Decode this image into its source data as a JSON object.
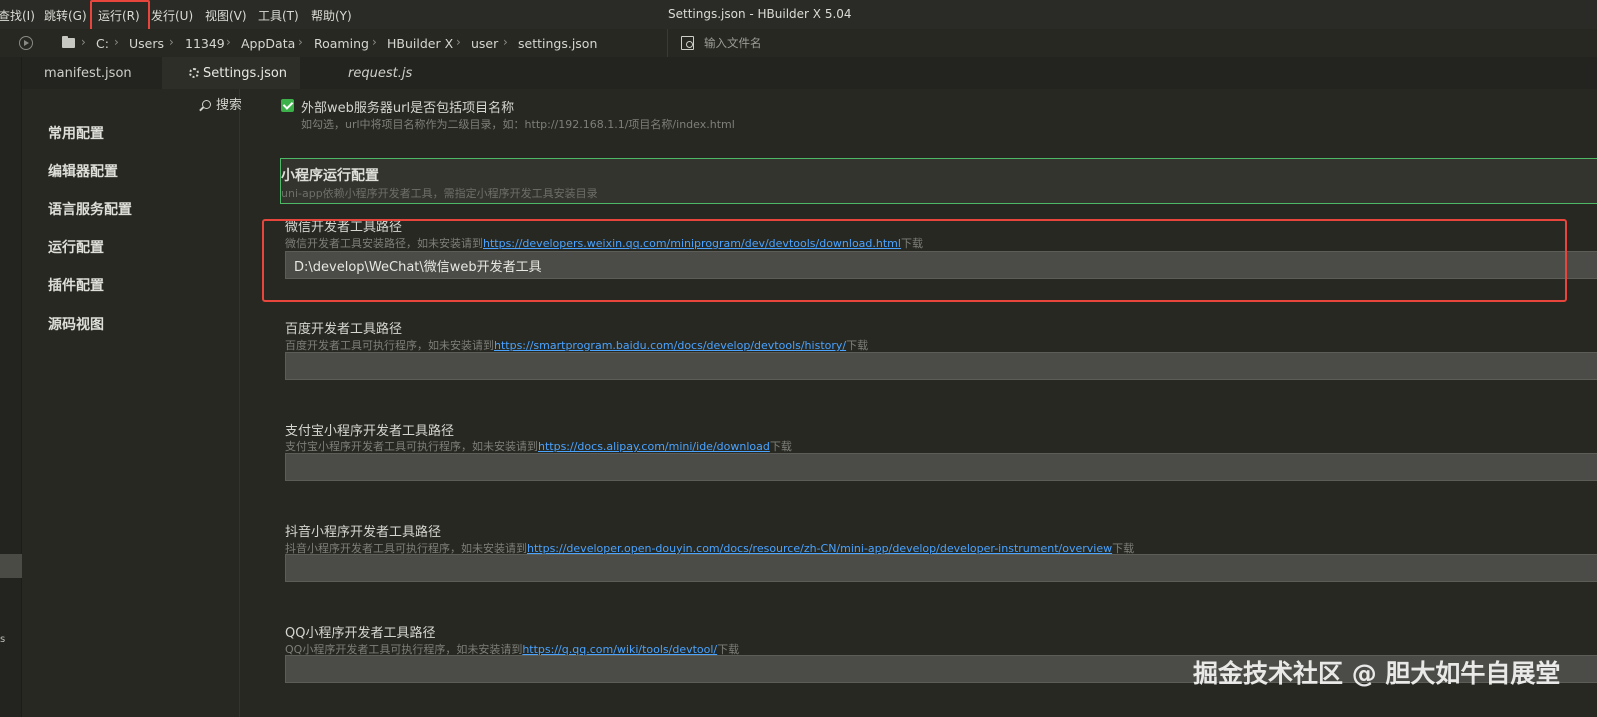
{
  "menubar": {
    "items": [
      "查找(I)",
      "跳转(G)",
      "运行(R)",
      "发行(U)",
      "视图(V)",
      "工具(T)",
      "帮助(Y)"
    ],
    "window_title": "Settings.json - HBuilder X 5.04"
  },
  "pathbar": {
    "crumbs": [
      "C:",
      "Users",
      "11349",
      "AppData",
      "Roaming",
      "HBuilder X",
      "user",
      "settings.json"
    ],
    "search_placeholder": "输入文件名"
  },
  "tabs": [
    {
      "label": "manifest.json"
    },
    {
      "label": "Settings.json"
    },
    {
      "label": "request.js"
    }
  ],
  "sidebar": {
    "search_label": "搜索",
    "items": [
      "常用配置",
      "编辑器配置",
      "语言服务配置",
      "运行配置",
      "插件配置",
      "源码视图"
    ]
  },
  "settings": {
    "external_url": {
      "label": "外部web服务器url是否包括项目名称",
      "desc": "如勾选，url中将项目名称作为二级目录，如：http://192.168.1.1/项目名称/index.html",
      "checked": true
    },
    "section": {
      "title": "小程序运行配置",
      "desc": "uni-app依赖小程序开发者工具，需指定小程序开发工具安装目录"
    },
    "wechat": {
      "label": "微信开发者工具路径",
      "desc_prefix": "微信开发者工具安装路径，如未安装请到",
      "link": "https://developers.weixin.qq.com/miniprogram/dev/devtools/download.html",
      "desc_suffix": "下载",
      "value": "D:\\develop\\WeChat\\微信web开发者工具"
    },
    "baidu": {
      "label": "百度开发者工具路径",
      "desc_prefix": "百度开发者工具可执行程序，如未安装请到",
      "link": "https://smartprogram.baidu.com/docs/develop/devtools/history/",
      "desc_suffix": "下载",
      "value": ""
    },
    "alipay": {
      "label": "支付宝小程序开发者工具路径",
      "desc_prefix": "支付宝小程序开发者工具可执行程序，如未安装请到",
      "link": "https://docs.alipay.com/mini/ide/download",
      "desc_suffix": "下载",
      "value": ""
    },
    "douyin": {
      "label": "抖音小程序开发者工具路径",
      "desc_prefix": "抖音小程序开发者工具可执行程序，如未安装请到",
      "link": "https://developer.open-douyin.com/docs/resource/zh-CN/mini-app/develop/developer-instrument/overview",
      "desc_suffix": "下载",
      "value": ""
    },
    "qq": {
      "label": "QQ小程序开发者工具路径",
      "desc_prefix": "QQ小程序开发者工具可执行程序，如未安装请到",
      "link": "https://q.qq.com/wiki/tools/devtool/",
      "desc_suffix": "下载",
      "value": ""
    }
  },
  "watermark": "掘金技术社区 @ 胆大如牛自展堂",
  "colors": {
    "accent_green": "#3cb14a",
    "highlight_red": "#e8453c",
    "link": "#4aa3ff"
  }
}
